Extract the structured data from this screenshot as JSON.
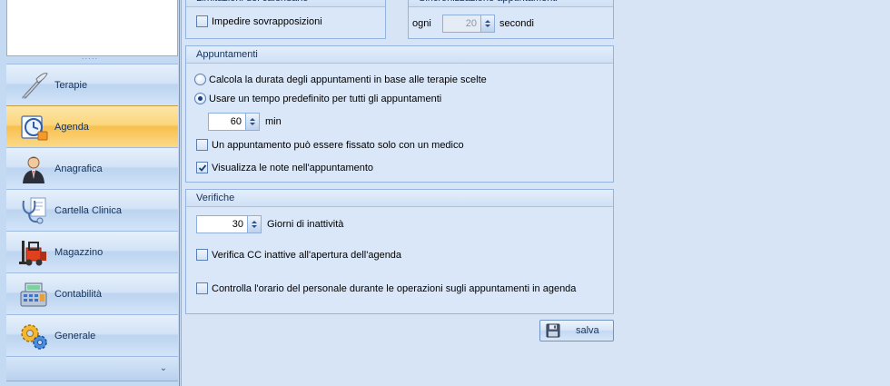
{
  "nav": {
    "grip": "·····",
    "items": [
      {
        "label": "Terapie",
        "icon": "scalpel-icon",
        "active": false
      },
      {
        "label": "Agenda",
        "icon": "agenda-clock-icon",
        "active": true
      },
      {
        "label": "Anagrafica",
        "icon": "person-icon",
        "active": false
      },
      {
        "label": "Cartella Clinica",
        "icon": "stethoscope-icon",
        "active": false
      },
      {
        "label": "Magazzino",
        "icon": "forklift-icon",
        "active": false
      },
      {
        "label": "Contabilità",
        "icon": "cash-register-icon",
        "active": false
      },
      {
        "label": "Generale",
        "icon": "gears-icon",
        "active": false
      }
    ],
    "chevron": "⌄"
  },
  "limitations": {
    "title": "Limitazioni del calendario",
    "overlap_label": "Impedire sovrapposizioni",
    "overlap_checked": false
  },
  "sync": {
    "title": "Sincronizzazione appuntamenti",
    "every_label": "ogni",
    "seconds_value": "20",
    "seconds_label": "secondi"
  },
  "appointments": {
    "title": "Appuntamenti",
    "radio_calc_label": "Calcola la durata degli appuntamenti in base alle terapie scelte",
    "radio_default_label": "Usare un tempo predefinito per tutti gli appuntamenti",
    "selected": "default",
    "minutes_value": "60",
    "minutes_label": "min",
    "single_doctor_label": "Un appuntamento può essere fissato solo con un medico",
    "single_doctor_checked": false,
    "show_notes_label": "Visualizza le note nell'appuntamento",
    "show_notes_checked": true
  },
  "checks": {
    "title": "Verifiche",
    "inactivity_value": "30",
    "inactivity_label": "Giorni di inattività",
    "cc_inactive_label": "Verifica CC inattive all'apertura dell'agenda",
    "cc_inactive_checked": false,
    "staff_schedule_label": "Controlla l'orario del personale durante le operazioni sugli appuntamenti in agenda",
    "staff_schedule_checked": false
  },
  "save_label": "salva",
  "colors": {
    "accent": "#f8c04e",
    "panel": "#d9e7f8",
    "border": "#93b4de",
    "text_dark": "#15325a"
  }
}
